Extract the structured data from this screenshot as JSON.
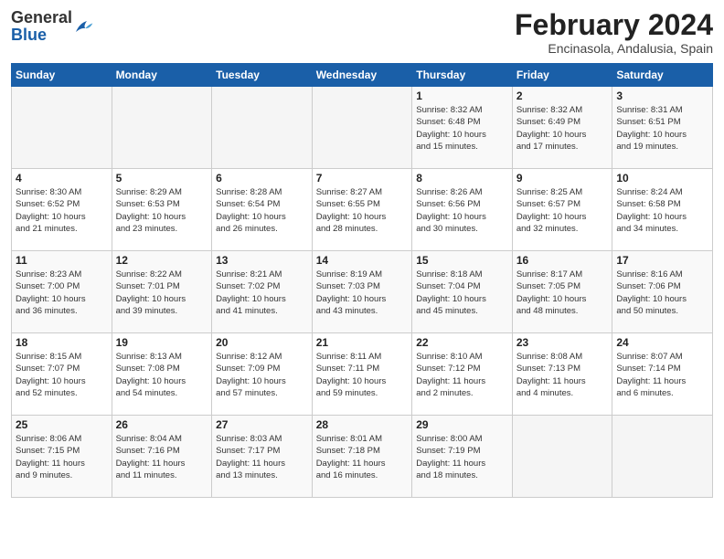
{
  "header": {
    "logo_general": "General",
    "logo_blue": "Blue",
    "month_year": "February 2024",
    "location": "Encinasola, Andalusia, Spain"
  },
  "days_of_week": [
    "Sunday",
    "Monday",
    "Tuesday",
    "Wednesday",
    "Thursday",
    "Friday",
    "Saturday"
  ],
  "weeks": [
    [
      {
        "day": "",
        "info": ""
      },
      {
        "day": "",
        "info": ""
      },
      {
        "day": "",
        "info": ""
      },
      {
        "day": "",
        "info": ""
      },
      {
        "day": "1",
        "info": "Sunrise: 8:32 AM\nSunset: 6:48 PM\nDaylight: 10 hours\nand 15 minutes."
      },
      {
        "day": "2",
        "info": "Sunrise: 8:32 AM\nSunset: 6:49 PM\nDaylight: 10 hours\nand 17 minutes."
      },
      {
        "day": "3",
        "info": "Sunrise: 8:31 AM\nSunset: 6:51 PM\nDaylight: 10 hours\nand 19 minutes."
      }
    ],
    [
      {
        "day": "4",
        "info": "Sunrise: 8:30 AM\nSunset: 6:52 PM\nDaylight: 10 hours\nand 21 minutes."
      },
      {
        "day": "5",
        "info": "Sunrise: 8:29 AM\nSunset: 6:53 PM\nDaylight: 10 hours\nand 23 minutes."
      },
      {
        "day": "6",
        "info": "Sunrise: 8:28 AM\nSunset: 6:54 PM\nDaylight: 10 hours\nand 26 minutes."
      },
      {
        "day": "7",
        "info": "Sunrise: 8:27 AM\nSunset: 6:55 PM\nDaylight: 10 hours\nand 28 minutes."
      },
      {
        "day": "8",
        "info": "Sunrise: 8:26 AM\nSunset: 6:56 PM\nDaylight: 10 hours\nand 30 minutes."
      },
      {
        "day": "9",
        "info": "Sunrise: 8:25 AM\nSunset: 6:57 PM\nDaylight: 10 hours\nand 32 minutes."
      },
      {
        "day": "10",
        "info": "Sunrise: 8:24 AM\nSunset: 6:58 PM\nDaylight: 10 hours\nand 34 minutes."
      }
    ],
    [
      {
        "day": "11",
        "info": "Sunrise: 8:23 AM\nSunset: 7:00 PM\nDaylight: 10 hours\nand 36 minutes."
      },
      {
        "day": "12",
        "info": "Sunrise: 8:22 AM\nSunset: 7:01 PM\nDaylight: 10 hours\nand 39 minutes."
      },
      {
        "day": "13",
        "info": "Sunrise: 8:21 AM\nSunset: 7:02 PM\nDaylight: 10 hours\nand 41 minutes."
      },
      {
        "day": "14",
        "info": "Sunrise: 8:19 AM\nSunset: 7:03 PM\nDaylight: 10 hours\nand 43 minutes."
      },
      {
        "day": "15",
        "info": "Sunrise: 8:18 AM\nSunset: 7:04 PM\nDaylight: 10 hours\nand 45 minutes."
      },
      {
        "day": "16",
        "info": "Sunrise: 8:17 AM\nSunset: 7:05 PM\nDaylight: 10 hours\nand 48 minutes."
      },
      {
        "day": "17",
        "info": "Sunrise: 8:16 AM\nSunset: 7:06 PM\nDaylight: 10 hours\nand 50 minutes."
      }
    ],
    [
      {
        "day": "18",
        "info": "Sunrise: 8:15 AM\nSunset: 7:07 PM\nDaylight: 10 hours\nand 52 minutes."
      },
      {
        "day": "19",
        "info": "Sunrise: 8:13 AM\nSunset: 7:08 PM\nDaylight: 10 hours\nand 54 minutes."
      },
      {
        "day": "20",
        "info": "Sunrise: 8:12 AM\nSunset: 7:09 PM\nDaylight: 10 hours\nand 57 minutes."
      },
      {
        "day": "21",
        "info": "Sunrise: 8:11 AM\nSunset: 7:11 PM\nDaylight: 10 hours\nand 59 minutes."
      },
      {
        "day": "22",
        "info": "Sunrise: 8:10 AM\nSunset: 7:12 PM\nDaylight: 11 hours\nand 2 minutes."
      },
      {
        "day": "23",
        "info": "Sunrise: 8:08 AM\nSunset: 7:13 PM\nDaylight: 11 hours\nand 4 minutes."
      },
      {
        "day": "24",
        "info": "Sunrise: 8:07 AM\nSunset: 7:14 PM\nDaylight: 11 hours\nand 6 minutes."
      }
    ],
    [
      {
        "day": "25",
        "info": "Sunrise: 8:06 AM\nSunset: 7:15 PM\nDaylight: 11 hours\nand 9 minutes."
      },
      {
        "day": "26",
        "info": "Sunrise: 8:04 AM\nSunset: 7:16 PM\nDaylight: 11 hours\nand 11 minutes."
      },
      {
        "day": "27",
        "info": "Sunrise: 8:03 AM\nSunset: 7:17 PM\nDaylight: 11 hours\nand 13 minutes."
      },
      {
        "day": "28",
        "info": "Sunrise: 8:01 AM\nSunset: 7:18 PM\nDaylight: 11 hours\nand 16 minutes."
      },
      {
        "day": "29",
        "info": "Sunrise: 8:00 AM\nSunset: 7:19 PM\nDaylight: 11 hours\nand 18 minutes."
      },
      {
        "day": "",
        "info": ""
      },
      {
        "day": "",
        "info": ""
      }
    ]
  ]
}
